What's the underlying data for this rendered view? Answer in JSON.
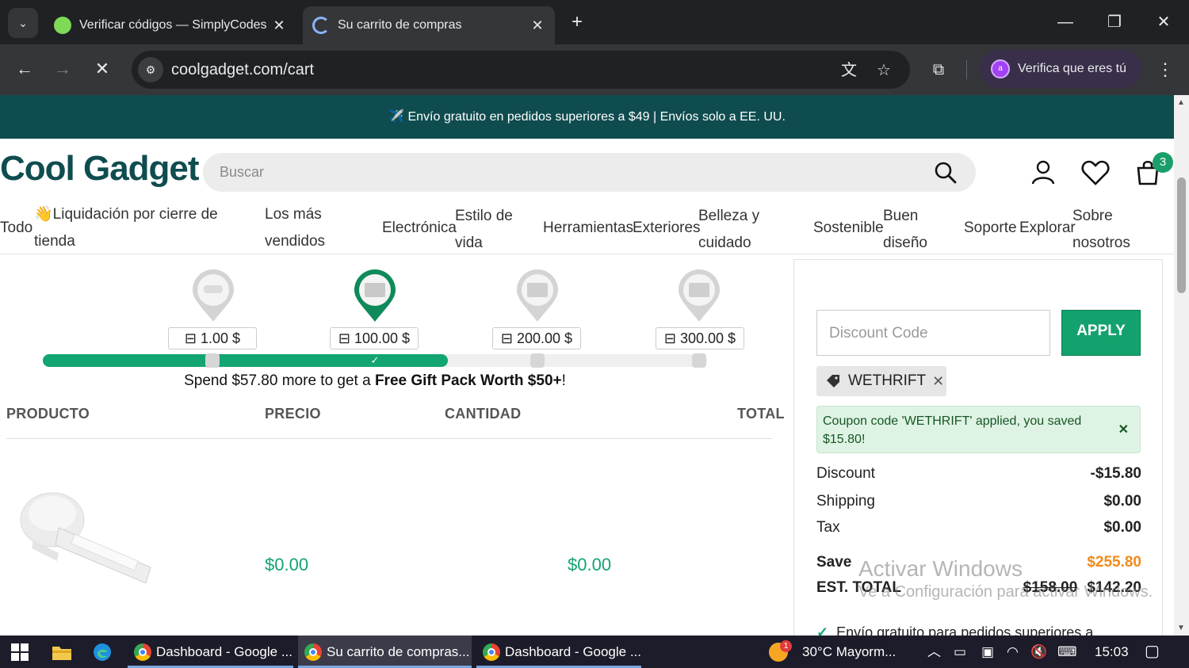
{
  "browser": {
    "tabs": [
      {
        "title": "Verificar códigos — SimplyCodes",
        "active": false
      },
      {
        "title": "Su carrito de compras",
        "active": true
      }
    ],
    "url": "coolgadget.com/cart",
    "verify_label": "Verifica que eres tú",
    "profile_initial": "a"
  },
  "site": {
    "announcement": "✈️ Envío gratuito en pedidos superiores a $49 | Envíos solo a EE. UU.",
    "logo": "Cool Gadget",
    "search_placeholder": "Buscar",
    "cart_count": "3",
    "nav": {
      "todo": "Todo",
      "liquidacion_1": "👋Liquidación por cierre de",
      "liquidacion_2": "tienda",
      "mas_1": "Los más",
      "mas_2": "vendidos",
      "electronica": "Electrónica",
      "estilo_1": "Estilo de",
      "estilo_2": "vida",
      "herramientas": "Herramientas",
      "exteriores": "Exteriores",
      "belleza_1": "Belleza y",
      "belleza_2": "cuidado",
      "sostenible": "Sostenible",
      "buen_1": "Buen",
      "buen_2": "diseño",
      "soporte": "Soporte",
      "explorar": "Explorar",
      "sobre_1": "Sobre",
      "sobre_2": "nosotros"
    }
  },
  "gift_progress": {
    "tiers": [
      "1.00 $",
      "100.00 $",
      "200.00 $",
      "300.00 $"
    ],
    "progress_fraction": 0.61,
    "check": "✓",
    "message_pre": "Spend $57.80 more to get a ",
    "message_bold": "Free Gift Pack Worth $50+",
    "message_post": "!"
  },
  "cart_table": {
    "headers": {
      "producto": "PRODUCTO",
      "precio": "PRECIO",
      "cantidad": "CANTIDAD",
      "total": "TOTAL"
    },
    "rows": [
      {
        "price": "$0.00",
        "total": "$0.00"
      }
    ]
  },
  "summary": {
    "discount_placeholder": "Discount Code",
    "apply_label": "APPLY",
    "applied_code": "WETHRIFT",
    "coupon_message": "Coupon code 'WETHRIFT' applied, you saved $15.80!",
    "discount_label": "Discount",
    "discount_value": "-$15.80",
    "shipping_label": "Shipping",
    "shipping_value": "$0.00",
    "tax_label": "Tax",
    "tax_value": "$0.00",
    "save_label": "Save",
    "save_value": "$255.80",
    "est_total_label": "EST. TOTAL",
    "est_total_original": "$158.00",
    "est_total_value": "$142.20",
    "free_shipping": "Envío gratuito para pedidos superiores a"
  },
  "watermark": {
    "line1": "Activar Windows",
    "line2": "Ve a Configuración para activar Windows."
  },
  "taskbar": {
    "items": [
      "Dashboard - Google ...",
      "Su carrito de compras...",
      "Dashboard - Google ..."
    ],
    "weather": "30°C  Mayorm...",
    "weather_badge": "1",
    "time": "15:03"
  },
  "colors": {
    "brand_teal": "#0f4c4f",
    "accent_green": "#12a56f",
    "save_orange": "#f08a1c"
  }
}
